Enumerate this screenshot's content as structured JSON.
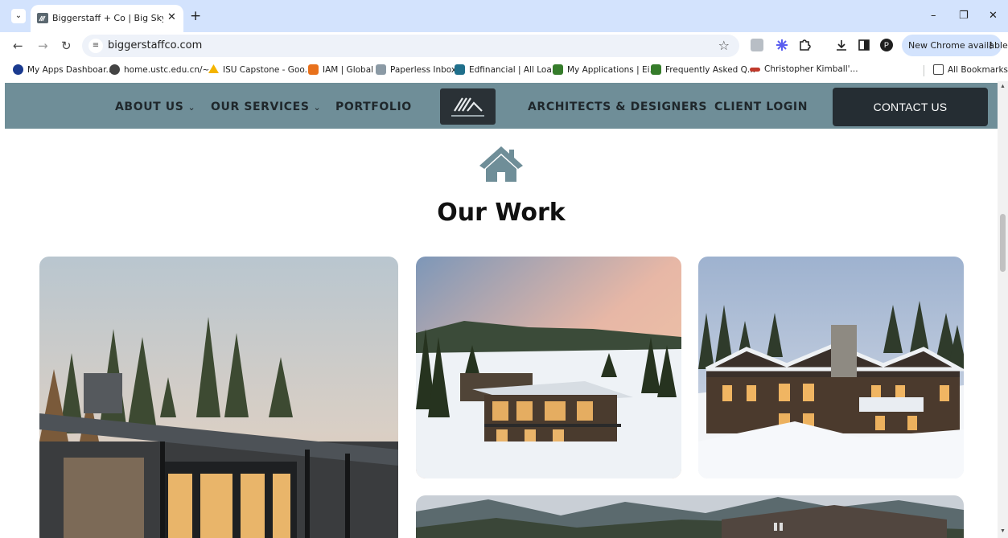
{
  "browser": {
    "tab_title": "Biggerstaff + Co | Big Sky Mont",
    "tab_close": "✕",
    "new_tab": "+",
    "window_controls": {
      "minimize": "–",
      "restore": "❐",
      "close": "✕"
    },
    "url": "biggerstaffco.com",
    "update_label": "New Chrome available",
    "update_dots": "⋮",
    "bookmarks": [
      {
        "label": "My Apps Dashboar...",
        "icon": "circle-o-icon",
        "color": "#1a3a8f"
      },
      {
        "label": "home.ustc.edu.cn/~...",
        "icon": "globe-icon",
        "color": "#444444"
      },
      {
        "label": "ISU Capstone - Goo...",
        "icon": "google-drive-icon",
        "color": "#f4b400"
      },
      {
        "label": "IAM | Global",
        "icon": "cube-icon",
        "color": "#e8711c"
      },
      {
        "label": "Paperless Inbox",
        "icon": "paperless-icon",
        "color": "#8b9aa5"
      },
      {
        "label": "Edfinancial | All Loa...",
        "icon": "ed-icon",
        "color": "#1f6f8b"
      },
      {
        "label": "My Applications | Ei...",
        "icon": "john-deere-icon",
        "color": "#367c2b"
      },
      {
        "label": "Frequently Asked Q...",
        "icon": "john-deere-icon",
        "color": "#367c2b"
      },
      {
        "label": "Christopher Kimball'...",
        "icon": "link-icon",
        "color": "#c0392b"
      }
    ],
    "all_bookmarks": "All Bookmarks"
  },
  "site": {
    "nav": {
      "about": "ABOUT US",
      "services": "OUR SERVICES",
      "portfolio": "PORTFOLIO",
      "architects": "ARCHITECTS & DESIGNERS",
      "client_login": "CLIENT LOGIN",
      "contact": "CONTACT US",
      "chevron": "⌄"
    },
    "colors": {
      "nav_bg": "#6f8e98",
      "contact_bg": "#252d33",
      "icon": "#6f8e98"
    },
    "section_title": "Our Work"
  }
}
